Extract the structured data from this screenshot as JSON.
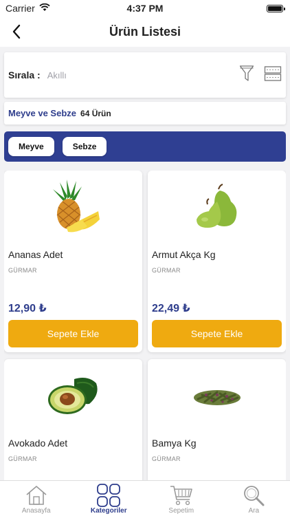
{
  "status": {
    "carrier": "Carrier",
    "time": "4:37 PM"
  },
  "nav": {
    "title": "Ürün Listesi"
  },
  "sort": {
    "label": "Sırala :",
    "value": "Akıllı"
  },
  "category": {
    "name": "Meyve ve Sebze",
    "count": "64 Ürün"
  },
  "chips": [
    {
      "label": "Meyve"
    },
    {
      "label": "Sebze"
    }
  ],
  "products": [
    {
      "name": "Ananas Adet",
      "brand": "GÜRMAR",
      "price": "12,90 ₺",
      "button": "Sepete Ekle",
      "image": "pineapple"
    },
    {
      "name": "Armut Akça Kg",
      "brand": "GÜRMAR",
      "price": "22,49 ₺",
      "button": "Sepete Ekle",
      "image": "pear"
    },
    {
      "name": "Avokado Adet",
      "brand": "GÜRMAR",
      "price": "",
      "button": "",
      "image": "avocado"
    },
    {
      "name": "Bamya Kg",
      "brand": "GÜRMAR",
      "price": "",
      "button": "",
      "image": "okra"
    }
  ],
  "tabs": [
    {
      "label": "Anasayfa",
      "icon": "home-icon",
      "active": false
    },
    {
      "label": "Kategoriler",
      "icon": "categories-icon",
      "active": true
    },
    {
      "label": "Sepetim",
      "icon": "cart-icon",
      "active": false
    },
    {
      "label": "Ara",
      "icon": "search-icon",
      "active": false
    }
  ],
  "colors": {
    "primary": "#2e3d8c",
    "accent": "#efaa10",
    "chipBar": "#2f3f92"
  }
}
